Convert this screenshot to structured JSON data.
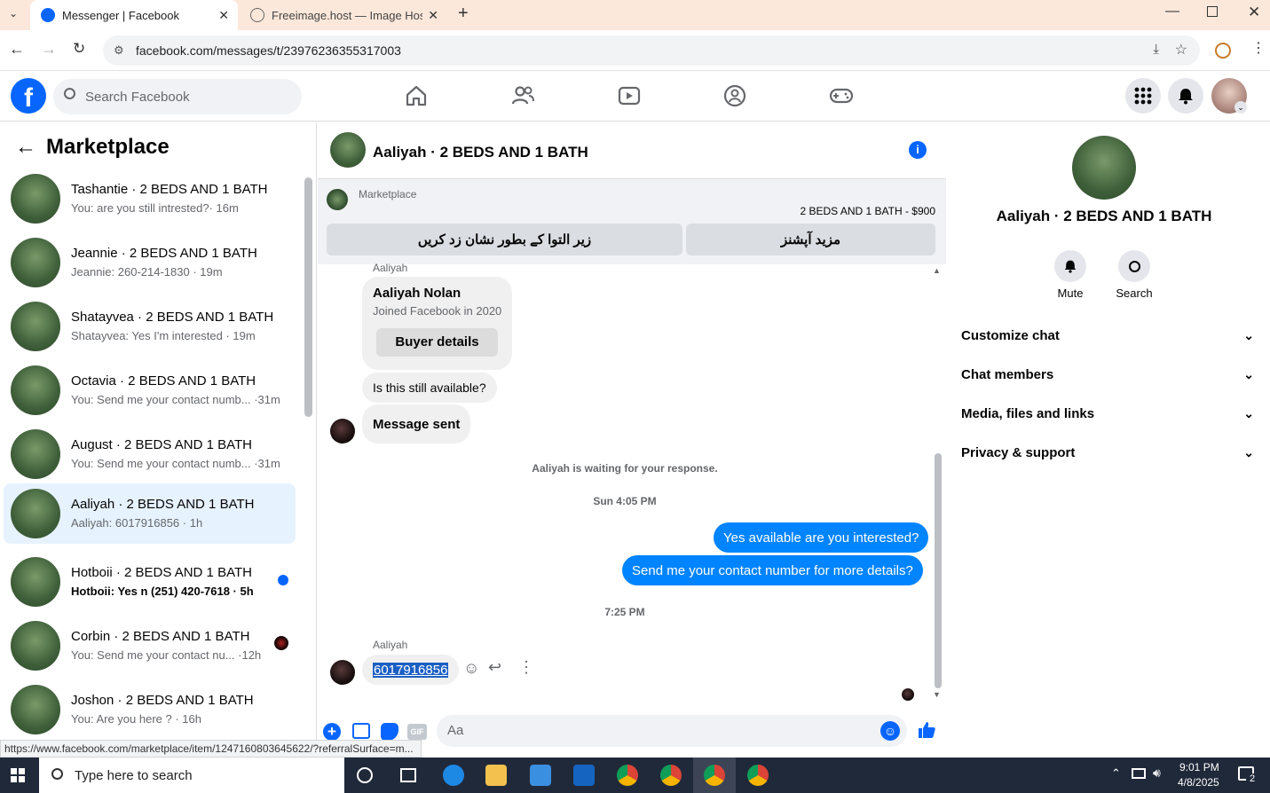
{
  "browser": {
    "tabs": [
      {
        "title": "Messenger | Facebook",
        "active": true
      },
      {
        "title": "Freeimage.host — Image Hosti",
        "active": false
      }
    ],
    "url": "facebook.com/messages/t/23976236355317003"
  },
  "fb": {
    "search_placeholder": "Search Facebook",
    "nav_icons": [
      "home-icon",
      "friends-icon",
      "watch-icon",
      "groups-icon",
      "gaming-icon"
    ],
    "brand_color": "#0866ff"
  },
  "left": {
    "title": "Marketplace",
    "conversations": [
      {
        "name": "Tashantie · 2 BEDS AND 1 BATH",
        "preview": "You: are you still intrested?· 16m",
        "unread": false
      },
      {
        "name": "Jeannie · 2 BEDS AND 1 BATH",
        "preview": "Jeannie: 260-214-1830 · 19m",
        "unread": false
      },
      {
        "name": "Shatayvea · 2 BEDS AND 1 BATH",
        "preview": "Shatayvea: Yes I'm interested · 19m",
        "unread": false
      },
      {
        "name": "Octavia · 2 BEDS AND 1 BATH",
        "preview": "You: Send me your contact numb... ·31m",
        "unread": false
      },
      {
        "name": "August · 2 BEDS AND 1 BATH",
        "preview": "You: Send me your contact numb... ·31m",
        "unread": false
      },
      {
        "name": "Aaliyah · 2 BEDS AND 1 BATH",
        "preview": "Aaliyah: 6017916856 · 1h",
        "unread": false,
        "selected": true
      },
      {
        "name": "Hotboii · 2 BEDS AND 1 BATH",
        "preview": "Hotboii: Yes n (251) 420-7618 · 5h",
        "unread": true
      },
      {
        "name": "Corbin · 2 BEDS AND 1 BATH",
        "preview": "You: Send me your contact nu... ·12h",
        "unread": false
      },
      {
        "name": "Joshon · 2 BEDS AND 1 BATH",
        "preview": "You: Are you here ? · 16h",
        "unread": false
      }
    ]
  },
  "chat": {
    "title": "Aaliyah · 2 BEDS AND 1 BATH",
    "marketplace_label": "Marketplace",
    "listing": "2 BEDS AND 1 BATH - $900",
    "btn_mark": "زیر التوا کے بطور نشان زد کریں",
    "btn_more": "مزید آپشنز",
    "sender_top": "Aaliyah",
    "card_name": "Aaliyah Nolan",
    "card_joined": "Joined Facebook in 2020",
    "card_button": "Buyer details",
    "msg_available": "Is this still available?",
    "msg_sent": "Message sent",
    "waiting": "Aaliyah is waiting for your response.",
    "time1": "Sun 4:05 PM",
    "reply1": "Yes available are you interested?",
    "reply2": "Send me your contact number for more details?",
    "time2": "7:25 PM",
    "sender_bottom": "Aaliyah",
    "phone": "6017916856",
    "composer_placeholder": "Aa",
    "gif_label": "GIF"
  },
  "right": {
    "name": "Aaliyah · 2 BEDS AND 1 BATH",
    "mute": "Mute",
    "search": "Search",
    "sections": [
      "Customize chat",
      "Chat members",
      "Media, files and links",
      "Privacy & support"
    ]
  },
  "status_url": "https://www.facebook.com/marketplace/item/1247160803645622/?referralSurface=m...",
  "taskbar": {
    "search": "Type here to search",
    "time": "9:01 PM",
    "date": "4/8/2025",
    "notif": "2"
  }
}
